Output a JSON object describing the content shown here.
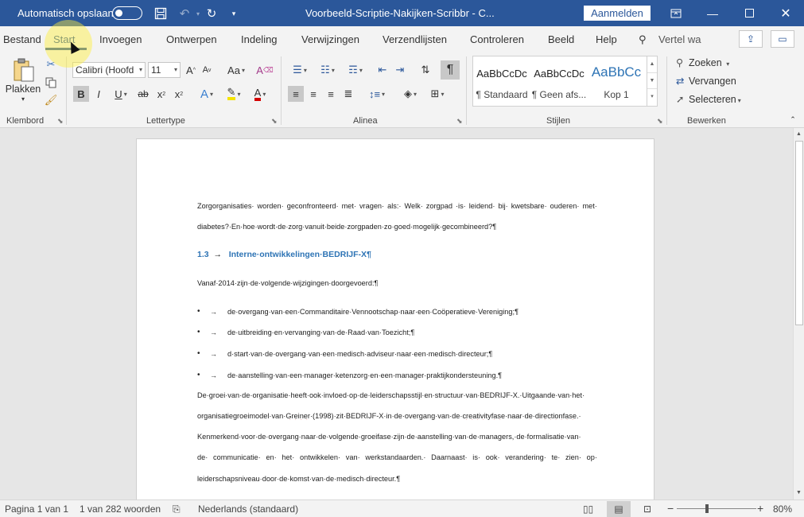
{
  "titlebar": {
    "autosave_label": "Automatisch opslaan",
    "autosave_on": false,
    "doc_title": "Voorbeeld-Scriptie-Nakijken-Scribbr  -  C...",
    "signin": "Aanmelden"
  },
  "tabs": [
    "Bestand",
    "Start",
    "Invoegen",
    "Ontwerpen",
    "Indeling",
    "Verwijzingen",
    "Verzendlijsten",
    "Controleren",
    "Beeld",
    "Help"
  ],
  "active_tab": "Start",
  "tell_me": "Vertel wa",
  "ribbon": {
    "clipboard": {
      "paste": "Plakken",
      "label": "Klembord"
    },
    "font": {
      "name": "Calibri (Hoofd",
      "size": "11",
      "label": "Lettertype",
      "change_case": "Aa",
      "grow": "A",
      "shrink": "A",
      "bold": "B",
      "italic": "I",
      "underline": "U",
      "strike": "ab",
      "subscript": "x",
      "sub_mark": "2",
      "superscript": "x",
      "sup_mark": "2",
      "text_effect": "A",
      "font_color": "A"
    },
    "paragraph": {
      "label": "Alinea"
    },
    "styles": {
      "label": "Stijlen",
      "items": [
        {
          "preview": "AaBbCcDc",
          "name": "¶ Standaard"
        },
        {
          "preview": "AaBbCcDc",
          "name": "¶ Geen afs..."
        },
        {
          "preview": "AaBbCc",
          "name": "Kop 1"
        }
      ]
    },
    "editing": {
      "label": "Bewerken",
      "find": "Zoeken",
      "replace": "Vervangen",
      "select": "Selecteren"
    }
  },
  "document": {
    "p1_line1": [
      "Zorgorganisaties·",
      "worden·",
      "geconfronteerd·",
      "met·",
      "vragen·",
      "als:·",
      "Welk·",
      "zorgpad",
      "·is·",
      "leidend·",
      "bij·",
      "kwetsbare·",
      "ouderen·",
      "met·"
    ],
    "p1_line2": "diabetes?·En·hoe·wordt·de·zorg·vanuit·beide·zorgpaden·zo·goed·mogelijk·gecombineerd?¶",
    "heading_num": "1.3",
    "heading_text": "Interne·ontwikkelingen·BEDRIJF-X¶",
    "intro": "Vanaf·2014·zijn·de·volgende·wijzigingen·doorgevoerd:¶",
    "bullets": [
      "de·overgang·van·een·Commanditaire·Vennootschap·naar·een·Coöperatieve·Vereniging;¶",
      "de·uitbreiding·en·vervanging·van·de·Raad·van·Toezicht;¶",
      "d·start·van·de·overgang·van·een·medisch·adviseur·naar·een·medisch·directeur;¶",
      "de·aanstelling·van·een·manager·ketenzorg·en·een·manager·praktijkondersteuning.¶"
    ],
    "p3_line1": "De·groei·van·de·organisatie·heeft·ook·invloed·op·de·leiderschapsstijl·en·structuur·van·BEDRIJF-X.·Uitgaande·van·het·",
    "p3_line2_a": "organisatiegroeimodel·van·",
    "p3_line2_greiner": "Greiner",
    "p3_line2_b": "·(1998)·zit·BEDRIJF-X·in·de·overgang·van·de·",
    "p3_line2_creativity": "creativityfase",
    "p3_line2_c": "·naar·de·",
    "p3_line2_direction": "directionfase",
    "p3_line2_d": ".·",
    "p3_line3": "Kenmerkend·voor·de·overgang·naar·de·volgende·groeifase·zijn·de·aanstelling·van·de·managers,·de·formalisatie·van·",
    "p3_line4": [
      "de·",
      "communicatie·",
      "en·",
      "het·",
      "ontwikkelen·",
      "van·",
      "werkstandaarden.·",
      "Daarnaast·",
      "is·",
      "ook·",
      "verandering·",
      "te·",
      "zien·",
      "op·"
    ],
    "p3_line5": "leiderschapsniveau·door·de·komst·van·de·medisch·directeur.¶"
  },
  "status": {
    "page": "Pagina 1 van 1",
    "words": "1 van 282 woorden",
    "language": "Nederlands (standaard)",
    "zoom": "80%",
    "zoom_fraction": 0.38
  },
  "colors": {
    "accent": "#2b579a",
    "heading": "#2e74b5"
  }
}
